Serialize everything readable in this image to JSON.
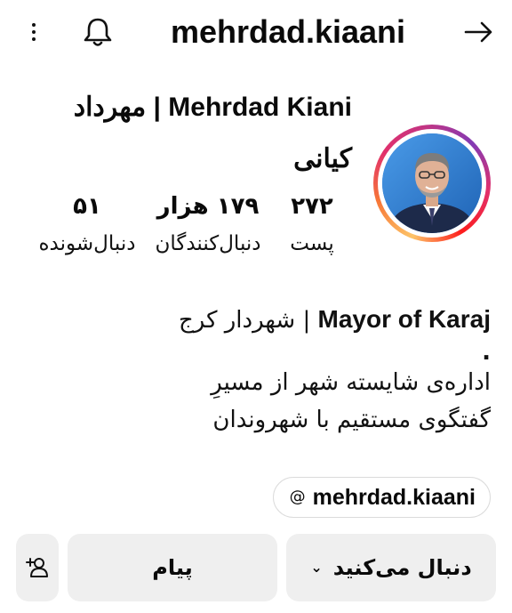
{
  "header": {
    "username": "mehrdad.kiaani",
    "icons": {
      "more": "more-vertical-icon",
      "notifications": "bell-icon",
      "back": "arrow-right-icon"
    }
  },
  "profile": {
    "display_name": "Mehrdad Kiani | مهرداد کیانی",
    "avatar_icon": "profile-photo",
    "stats": {
      "posts": {
        "value": "۲۷۲",
        "label": "پست"
      },
      "followers": {
        "value": "۱۷۹ هزار",
        "label": "دنبال‌کنندگان"
      },
      "following": {
        "value": "۵۱",
        "label": "دنبال‌شونده"
      }
    },
    "bio": {
      "line1_en": "Mayor of Karaj",
      "line1_sep": " | ",
      "line1_fa": "شهردار کرج",
      "dot": ".",
      "line2": "اداره‌ی شایسته شهر از مسیرِ",
      "line3": "گفتگوی مستقیم با شهروندان"
    },
    "threads_link": {
      "label": "mehrdad.kiaani",
      "icon": "threads-icon",
      "icon_glyph": "@"
    }
  },
  "actions": {
    "follow_label": "دنبال می‌کنید",
    "follow_chevron": "⌄",
    "message_label": "پیام",
    "suggest_icon": "add-person-icon"
  },
  "colors": {
    "button_bg": "#efefef",
    "story_ring": [
      "#fdc468",
      "#f77737",
      "#e1306c",
      "#833ab4"
    ],
    "avatar_bg": "#2f7fd6"
  }
}
